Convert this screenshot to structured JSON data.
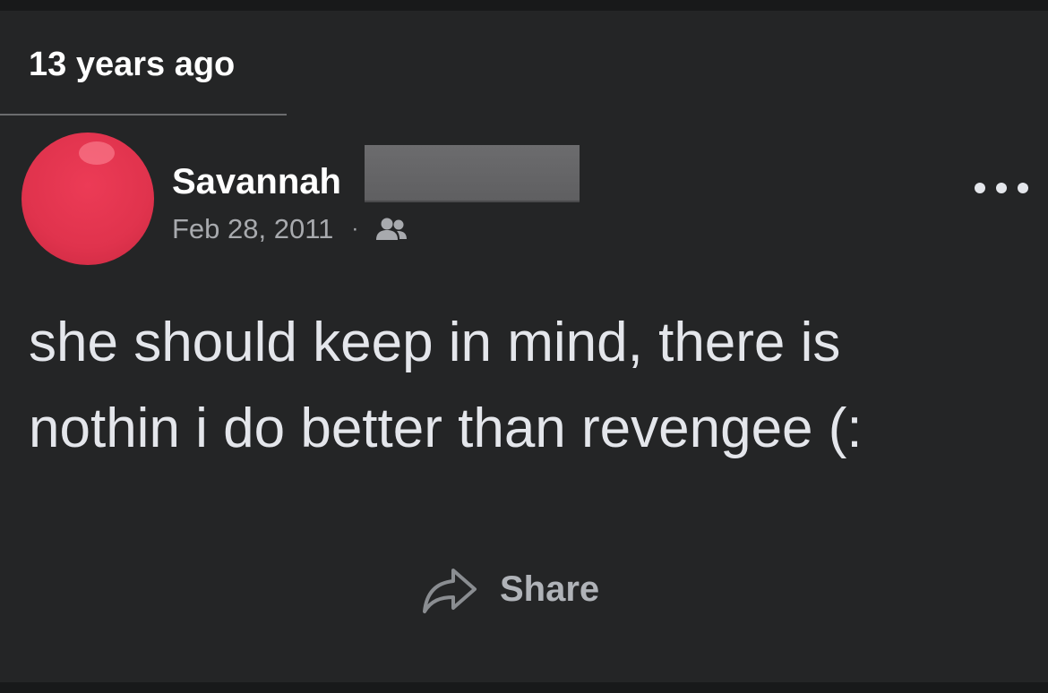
{
  "memory": {
    "label": "13 years ago"
  },
  "post": {
    "author_name": "Savannah",
    "date": "Feb 28, 2011",
    "meta_separator": "·",
    "audience_icon": "friends-icon",
    "text": "she should keep in mind, there is\nnothin i do better than revengee (:",
    "more_icon": "more-options-icon"
  },
  "actions": {
    "share_label": "Share",
    "share_icon": "share-arrow-icon"
  },
  "colors": {
    "background": "#242526",
    "avatar": "#e0334d",
    "text_primary": "#e4e6eb",
    "text_secondary": "#a8aaae"
  }
}
